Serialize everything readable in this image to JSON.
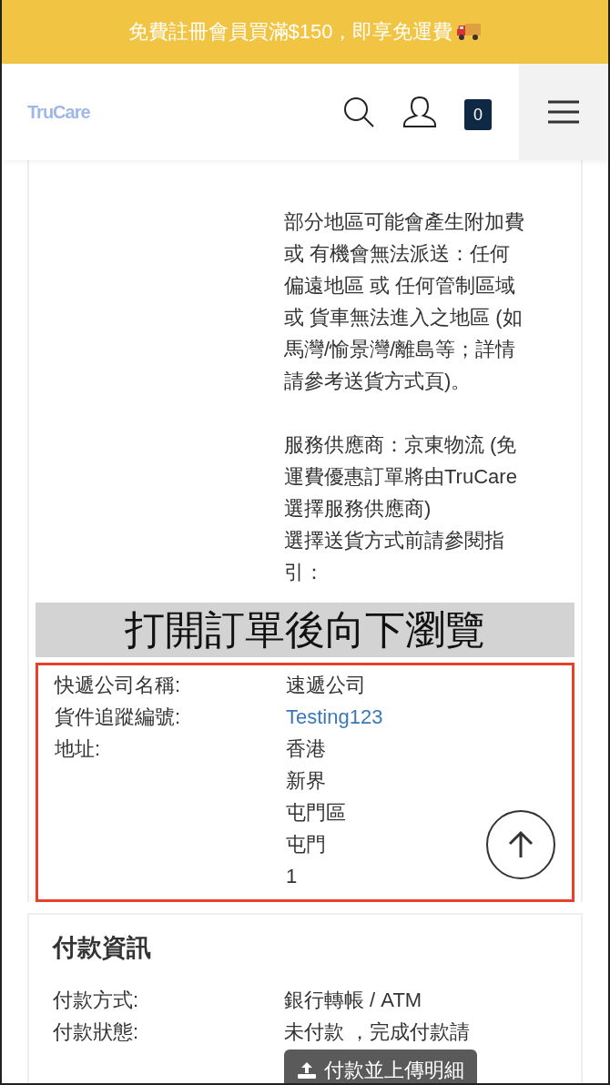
{
  "promo_banner": {
    "text": "免費註冊會員買滿$150，即享免運費"
  },
  "header": {
    "logo": "TruCare",
    "cart_count": "0"
  },
  "delivery_notes": [
    [
      "部分地區可能會產生附加費",
      "或 有機會無法派送：任何",
      "偏遠地區 或 任何管制區域",
      "或 貨車無法進入之地區 (如",
      "馬灣/愉景灣/離島等；詳情",
      "請參考送貨方式頁)。"
    ],
    [
      "服務供應商：京東物流 (免",
      "運費優惠訂單將由TruCare",
      "選擇服務供應商)",
      "選擇送貨方式前請參閱指",
      "引："
    ]
  ],
  "overlay_caption": "打開訂單後向下瀏覽",
  "shipping": [
    {
      "label": "快遞公司名稱:",
      "values": [
        "速遞公司"
      ],
      "kind": "text"
    },
    {
      "label": "貨件追蹤編號:",
      "values": [
        "Testing123"
      ],
      "kind": "link"
    },
    {
      "label": "地址:",
      "values": [
        "香港",
        "新界",
        "屯門區",
        "屯門",
        "1"
      ],
      "kind": "text"
    }
  ],
  "payment": {
    "title": "付款資訊",
    "rows": [
      {
        "label": "付款方式:",
        "value": "銀行轉帳 / ATM"
      },
      {
        "label": "付款狀態:",
        "value": "未付款 ，完成付款請"
      }
    ],
    "button": "付款並上傳明細"
  }
}
